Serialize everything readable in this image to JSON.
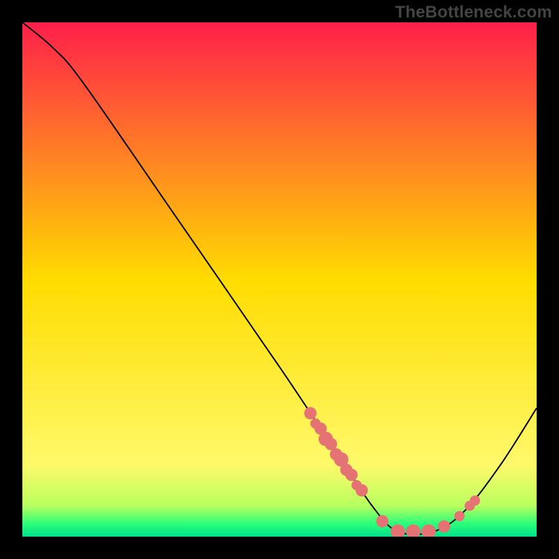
{
  "watermark": "TheBottleneck.com",
  "chart_data": {
    "type": "line",
    "title": "",
    "xlabel": "",
    "ylabel": "",
    "xlim": [
      0,
      100
    ],
    "ylim": [
      0,
      100
    ],
    "grid": false,
    "legend": false,
    "gradient_stops": [
      {
        "offset": 0,
        "color": "#ff1f4b"
      },
      {
        "offset": 0.5,
        "color": "#ffdc00"
      },
      {
        "offset": 0.86,
        "color": "#fff96a"
      },
      {
        "offset": 0.94,
        "color": "#b8ff5e"
      },
      {
        "offset": 0.975,
        "color": "#2bff7a"
      },
      {
        "offset": 1.0,
        "color": "#00e08c"
      }
    ],
    "curve": [
      {
        "x": 0,
        "y": 100
      },
      {
        "x": 6,
        "y": 95
      },
      {
        "x": 12,
        "y": 88
      },
      {
        "x": 30,
        "y": 62
      },
      {
        "x": 50,
        "y": 33
      },
      {
        "x": 60,
        "y": 18
      },
      {
        "x": 68,
        "y": 6
      },
      {
        "x": 73,
        "y": 1
      },
      {
        "x": 80,
        "y": 1
      },
      {
        "x": 86,
        "y": 5
      },
      {
        "x": 93,
        "y": 14
      },
      {
        "x": 100,
        "y": 25
      }
    ],
    "markers": [
      {
        "x": 56,
        "y": 24,
        "r": 1.2
      },
      {
        "x": 57,
        "y": 22,
        "r": 1.0
      },
      {
        "x": 58,
        "y": 21,
        "r": 1.2
      },
      {
        "x": 59,
        "y": 19,
        "r": 1.4
      },
      {
        "x": 60,
        "y": 18,
        "r": 1.2
      },
      {
        "x": 61,
        "y": 16,
        "r": 1.2
      },
      {
        "x": 62,
        "y": 15,
        "r": 1.4
      },
      {
        "x": 63,
        "y": 13,
        "r": 1.2
      },
      {
        "x": 64,
        "y": 12,
        "r": 1.2
      },
      {
        "x": 65,
        "y": 10,
        "r": 1.0
      },
      {
        "x": 66,
        "y": 9,
        "r": 1.2
      },
      {
        "x": 70,
        "y": 3,
        "r": 1.2
      },
      {
        "x": 73,
        "y": 1,
        "r": 1.4
      },
      {
        "x": 76,
        "y": 1,
        "r": 1.4
      },
      {
        "x": 79,
        "y": 1,
        "r": 1.4
      },
      {
        "x": 82,
        "y": 2,
        "r": 1.2
      },
      {
        "x": 85,
        "y": 4,
        "r": 1.0
      },
      {
        "x": 87,
        "y": 6,
        "r": 1.0
      },
      {
        "x": 88,
        "y": 7,
        "r": 1.0
      }
    ],
    "marker_color": "#e57373",
    "curve_color": "#000000"
  }
}
